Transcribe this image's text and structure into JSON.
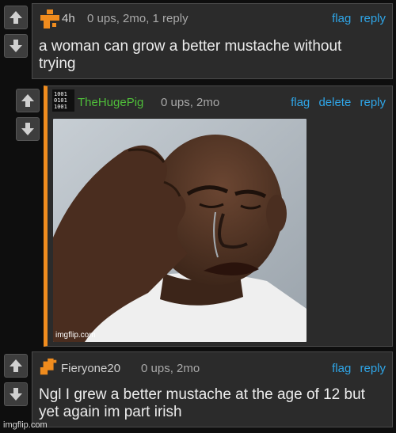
{
  "comments": [
    {
      "username": "4h",
      "meta": "0 ups, 2mo, 1 reply",
      "actions": [
        "flag",
        "reply"
      ],
      "text_lines": [
        "a woman can grow a better mustache without",
        "trying"
      ]
    },
    {
      "username": "TheHugePig",
      "meta": "0 ups, 2mo",
      "actions": [
        "flag",
        "delete",
        "reply"
      ],
      "image_watermark": "imgflip.com"
    },
    {
      "username": "Fieryone20",
      "meta": "0 ups, 2mo",
      "actions": [
        "flag",
        "reply"
      ],
      "text_lines": [
        "Ngl I grew a better mustache at the age of 12 but",
        "yet again im part irish"
      ]
    }
  ],
  "page_watermark": "imgflip.com",
  "colors": {
    "background": "#0e0e0e",
    "panel": "#2b2b2b",
    "link": "#2fa6e8",
    "accent_orange": "#f08c1e",
    "username_green": "#4fbf3a"
  },
  "icons": [
    "upvote-arrow-icon",
    "downvote-arrow-icon",
    "orange-block-avatar-icon",
    "binary-avatar-icon"
  ]
}
